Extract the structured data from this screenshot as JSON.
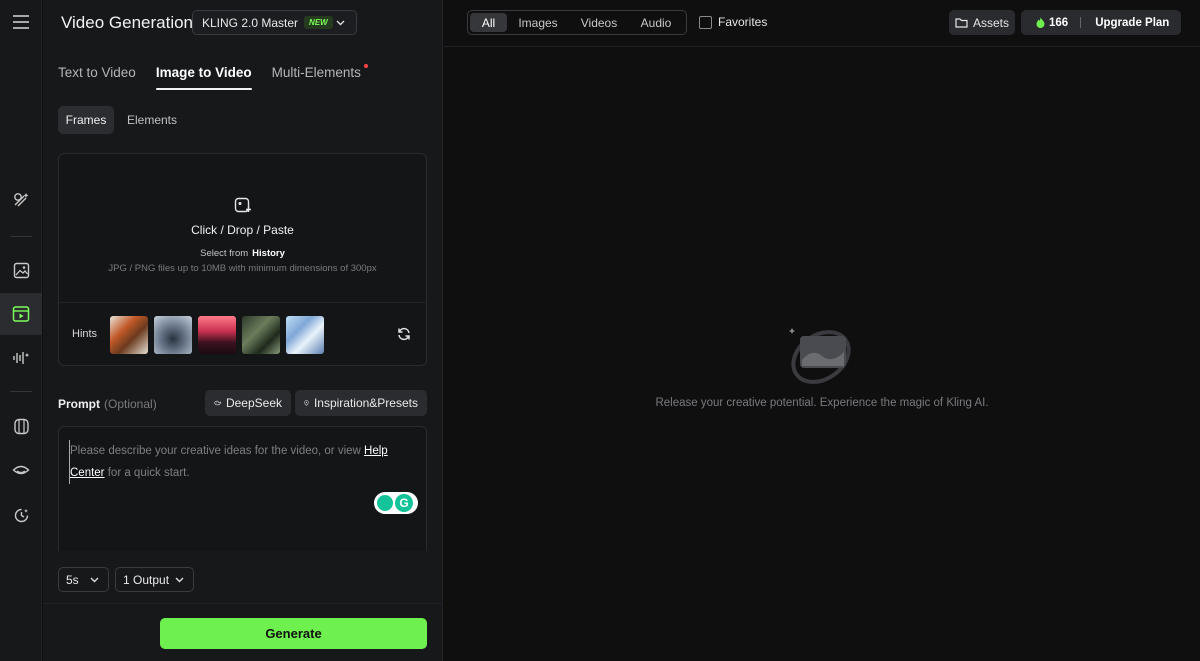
{
  "rail": {
    "items": [
      {
        "name": "menu-icon"
      },
      {
        "name": "sparkle-brush-icon"
      },
      {
        "name": "image-icon"
      },
      {
        "name": "video-icon",
        "active": true
      },
      {
        "name": "audio-icon"
      },
      {
        "name": "hexagon-icon"
      },
      {
        "name": "face-icon"
      },
      {
        "name": "history-icon"
      }
    ]
  },
  "header": {
    "title": "Video Generation",
    "model": "KLING 2.0 Master",
    "model_badge": "NEW"
  },
  "mode_tabs": [
    {
      "label": "Text to Video",
      "active": false
    },
    {
      "label": "Image to Video",
      "active": true
    },
    {
      "label": "Multi-Elements",
      "active": false,
      "dot": true
    }
  ],
  "sub_tabs": [
    {
      "label": "Frames",
      "active": true
    },
    {
      "label": "Elements",
      "active": false
    }
  ],
  "upload": {
    "main": "Click / Drop / Paste",
    "select_prefix": "Select from",
    "select_link": "History",
    "requirements": "JPG / PNG files up to 10MB with minimum dimensions of 300px",
    "hints_label": "Hints"
  },
  "prompt": {
    "label": "Prompt",
    "optional": "(Optional)",
    "deepseek": "DeepSeek",
    "inspiration": "Inspiration&Presets",
    "placeholder_a": "Please describe your creative ideas for the video, or view ",
    "placeholder_link": "Help Center",
    "placeholder_b": " for a quick start."
  },
  "options": {
    "duration": "5s",
    "outputs": "1 Output"
  },
  "generate_label": "Generate",
  "topbar": {
    "filters": [
      "All",
      "Images",
      "Videos",
      "Audio"
    ],
    "active_filter": "All",
    "favorites": "Favorites",
    "assets": "Assets",
    "credits": "166",
    "upgrade": "Upgrade Plan"
  },
  "empty_state": "Release your creative potential. Experience the magic of Kling AI.",
  "colors": {
    "accent": "#6ef14e",
    "panel_bg": "#17181a",
    "main_bg": "#0f0f10"
  }
}
